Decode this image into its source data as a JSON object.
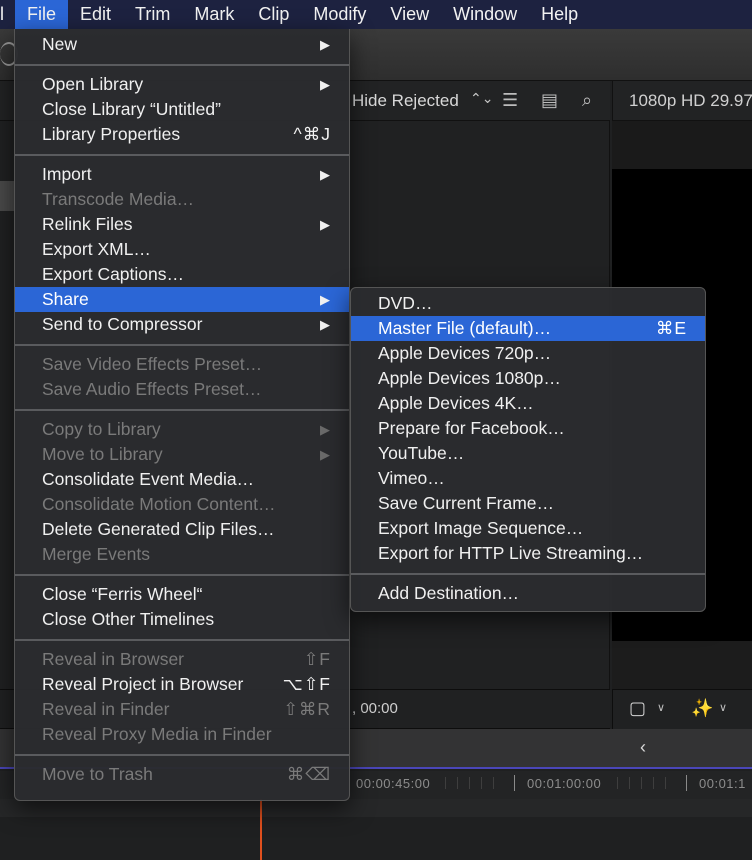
{
  "menubar": {
    "items": [
      {
        "label": "l"
      },
      {
        "label": "File"
      },
      {
        "label": "Edit"
      },
      {
        "label": "Trim"
      },
      {
        "label": "Mark"
      },
      {
        "label": "Clip"
      },
      {
        "label": "Modify"
      },
      {
        "label": "View"
      },
      {
        "label": "Window"
      },
      {
        "label": "Help"
      }
    ],
    "active": "File"
  },
  "browser": {
    "filter_label": "Hide Rejected",
    "filter_icon": "up-down-chevron-icon",
    "icons": [
      "list-view-icon",
      "filmstrip-icon",
      "search-icon"
    ]
  },
  "viewer": {
    "format_label": "1080p HD 29.97",
    "tools": [
      "transform-icon",
      "magic-wand-icon"
    ]
  },
  "status": {
    "timecode_fragment": ", 00:00"
  },
  "timeline": {
    "back_icon": "chevron-left-icon",
    "ruler_labels": [
      "00:00:45:00",
      "00:01:00:00",
      "00:01:1"
    ]
  },
  "file_menu": {
    "groups": [
      [
        {
          "label": "New",
          "submenu": true,
          "enabled": true
        }
      ],
      [
        {
          "label": "Open Library",
          "submenu": true,
          "enabled": true
        },
        {
          "label": "Close Library “Untitled”",
          "enabled": true
        },
        {
          "label": "Library Properties",
          "shortcut": "^⌘J",
          "enabled": true
        }
      ],
      [
        {
          "label": "Import",
          "submenu": true,
          "enabled": true
        },
        {
          "label": "Transcode Media…",
          "enabled": false
        },
        {
          "label": "Relink Files",
          "submenu": true,
          "enabled": true
        },
        {
          "label": "Export XML…",
          "enabled": true
        },
        {
          "label": "Export Captions…",
          "enabled": true
        },
        {
          "label": "Share",
          "submenu": true,
          "enabled": true,
          "highlighted": true
        },
        {
          "label": "Send to Compressor",
          "submenu": true,
          "enabled": true
        }
      ],
      [
        {
          "label": "Save Video Effects Preset…",
          "enabled": false
        },
        {
          "label": "Save Audio Effects Preset…",
          "enabled": false
        }
      ],
      [
        {
          "label": "Copy to Library",
          "submenu": true,
          "enabled": false
        },
        {
          "label": "Move to Library",
          "submenu": true,
          "enabled": false
        },
        {
          "label": "Consolidate Event Media…",
          "enabled": true
        },
        {
          "label": "Consolidate Motion Content…",
          "enabled": false
        },
        {
          "label": "Delete Generated Clip Files…",
          "enabled": true
        },
        {
          "label": "Merge Events",
          "enabled": false
        }
      ],
      [
        {
          "label": "Close “Ferris Wheel“",
          "enabled": true
        },
        {
          "label": "Close Other Timelines",
          "enabled": true
        }
      ],
      [
        {
          "label": "Reveal in Browser",
          "shortcut": "⇧F",
          "enabled": false
        },
        {
          "label": "Reveal Project in Browser",
          "shortcut": "⌥⇧F",
          "enabled": true
        },
        {
          "label": "Reveal in Finder",
          "shortcut": "⇧⌘R",
          "enabled": false
        },
        {
          "label": "Reveal Proxy Media in Finder",
          "enabled": false
        }
      ],
      [
        {
          "label": "Move to Trash",
          "shortcut": "⌘⌫",
          "enabled": false
        }
      ]
    ]
  },
  "share_menu": {
    "groups": [
      [
        {
          "label": "DVD…"
        },
        {
          "label": "Master File (default)…",
          "shortcut": "⌘E",
          "highlighted": true
        },
        {
          "label": "Apple Devices 720p…"
        },
        {
          "label": "Apple Devices 1080p…"
        },
        {
          "label": "Apple Devices 4K…"
        },
        {
          "label": "Prepare for Facebook…"
        },
        {
          "label": "YouTube…"
        },
        {
          "label": "Vimeo…"
        },
        {
          "label": "Save Current Frame…"
        },
        {
          "label": "Export Image Sequence…"
        },
        {
          "label": "Export for HTTP Live Streaming…"
        }
      ],
      [
        {
          "label": "Add Destination…"
        }
      ]
    ]
  },
  "colors": {
    "menubar_bg": "#1d2240",
    "highlight": "#2b66d6",
    "menu_bg": "#2a2b2e",
    "disabled_text": "#7a7a7a",
    "playhead": "#e0501e",
    "timeline_accent": "#4a46b8"
  }
}
